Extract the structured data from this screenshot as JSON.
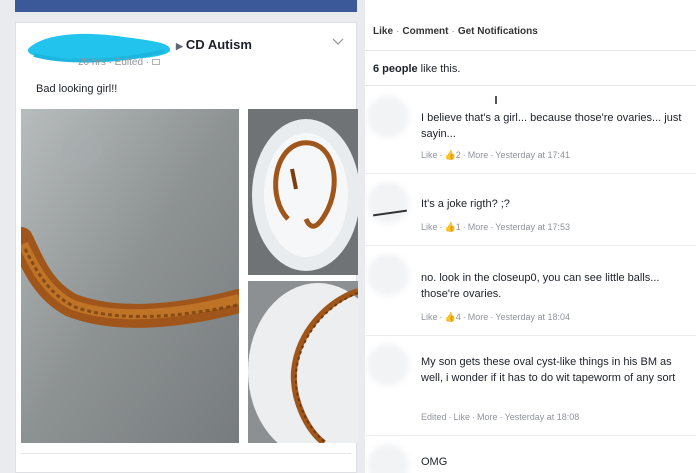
{
  "post": {
    "header_group": "CD Autism",
    "meta": "20 hrs · Edited · ",
    "text": "Bad looking girl!!"
  },
  "actions": {
    "like": "Like",
    "comment": "Comment",
    "notifications": "Get Notifications"
  },
  "likes": {
    "count": "6 people",
    "suffix": " like this."
  },
  "comments": [
    {
      "text": "I believe that's a girl... because those're ovaries... just sayin...",
      "like": "Like",
      "likes": "2",
      "more": "More",
      "time": "Yesterday at 17:41"
    },
    {
      "text": "It's a joke rigth? ;?",
      "like": "Like",
      "likes": "1",
      "more": "More",
      "time": "Yesterday at 17:53"
    },
    {
      "text": "no. look in the closeup0, you can see little balls... those're ovaries.",
      "like": "Like",
      "likes": "4",
      "more": "More",
      "time": "Yesterday at 18:04"
    },
    {
      "text": "My son gets these oval cyst-like things in his BM as well, i wonder if it has to do wit tapeworm of any sort",
      "edited": "Edited",
      "like": "Like",
      "more": "More",
      "time": "Yesterday at 18:08"
    },
    {
      "text": "OMG"
    }
  ],
  "colors": {
    "facebook_blue": "#3b5998",
    "meta_gray": "#90949c",
    "text_dark": "#1d2129",
    "stain_brown": "#a0561a"
  },
  "icons": {
    "like": "thumbs-up-icon",
    "menu": "chevron-down-icon",
    "arrow": "triangle-right-icon",
    "privacy": "globe-icon"
  }
}
